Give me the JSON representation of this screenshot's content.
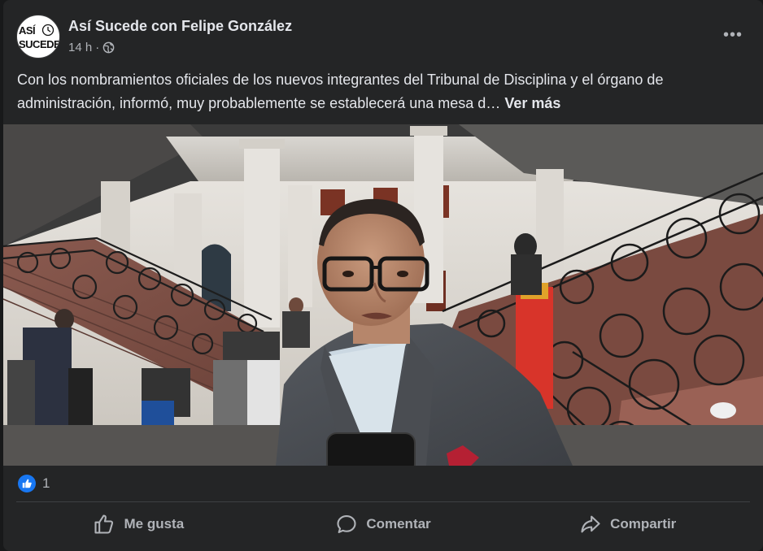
{
  "post": {
    "page_name": "Así Sucede con Felipe González",
    "avatar_text_line1": "ASÍ",
    "avatar_text_line2": "SUCEDE",
    "time": "14 h",
    "separator": "·",
    "privacy_icon": "globe-icon",
    "more_icon": "more-options-icon",
    "more_label": "•••",
    "text": "Con los nombramientos oficiales de los nuevos integrantes del Tribunal de Disciplina y el órgano de administración, informó, muy probablemente se establecerá una mesa d…",
    "see_more": "Ver más",
    "media_icon": "photo"
  },
  "reactions": {
    "icon": "like-icon",
    "count": "1"
  },
  "actions": [
    {
      "label": "Me gusta",
      "icon": "thumbs-up-icon"
    },
    {
      "label": "Comentar",
      "icon": "comment-icon"
    },
    {
      "label": "Compartir",
      "icon": "share-icon"
    }
  ],
  "colors": {
    "background": "#18191a",
    "card": "#242526",
    "primary_text": "#e4e6eb",
    "secondary_text": "#b0b3b8",
    "like_blue": "#1877f2"
  }
}
